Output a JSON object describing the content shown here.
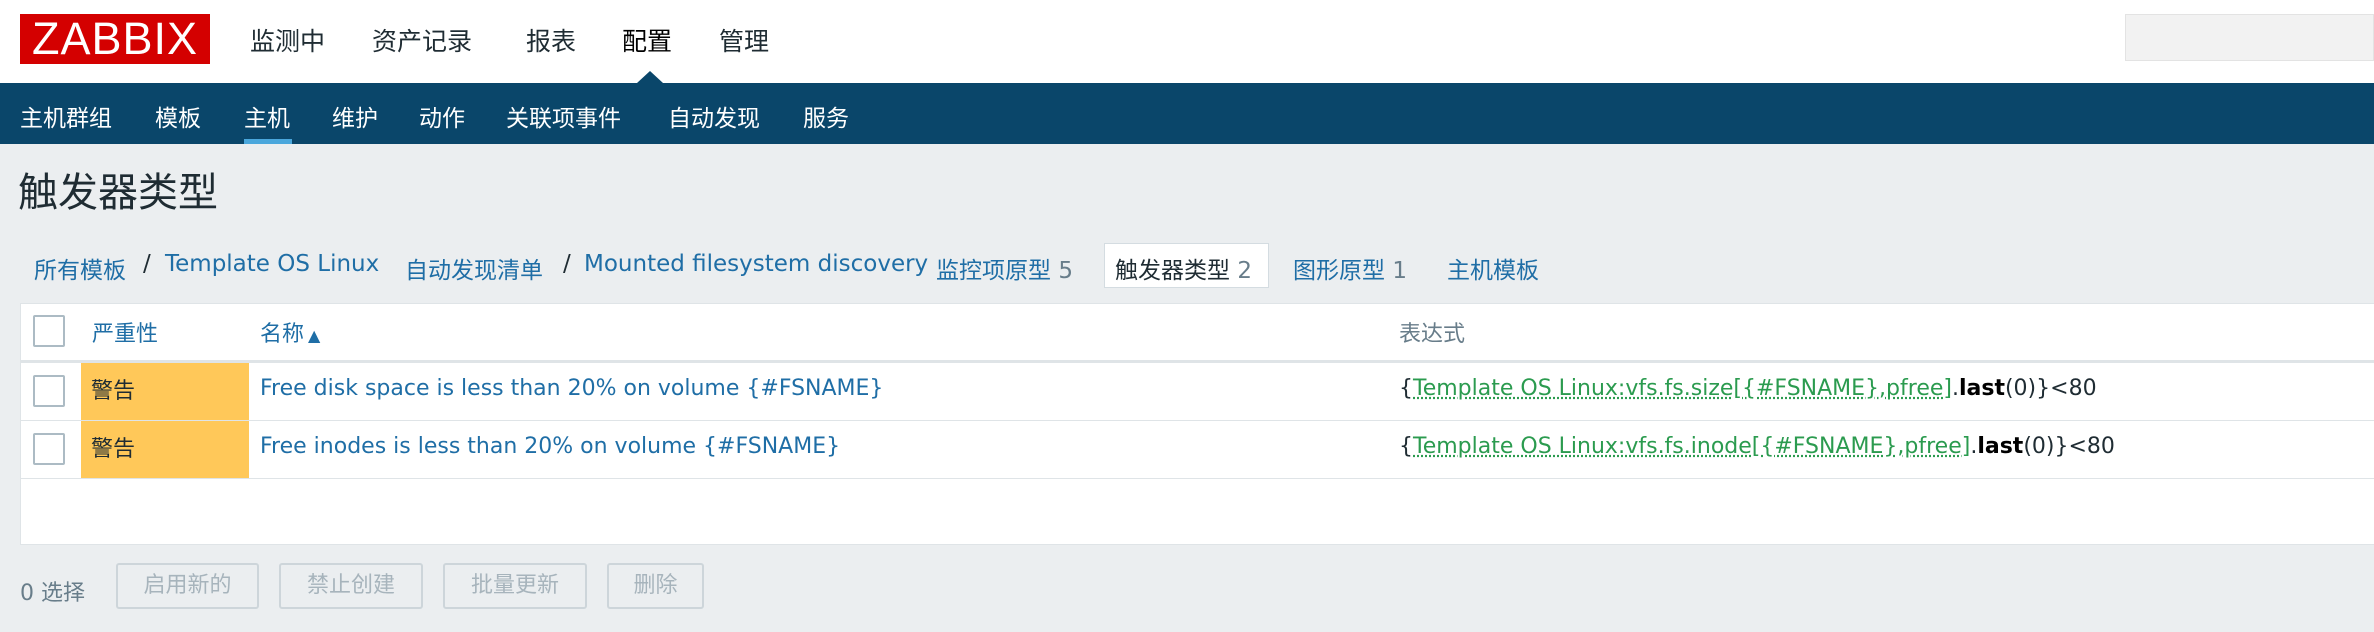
{
  "logo": "ZABBIX",
  "top_menu": [
    "监测中",
    "资产记录",
    "报表",
    "配置",
    "管理"
  ],
  "sub_nav": [
    "主机群组",
    "模板",
    "主机",
    "维护",
    "动作",
    "关联项事件",
    "自动发现",
    "服务"
  ],
  "page_title": "触发器类型",
  "breadcrumbs": {
    "all_templates": "所有模板",
    "sep1": "/",
    "template": "Template OS Linux",
    "discovery_list": "自动发现清单",
    "sep2": "/",
    "discovery_rule": "Mounted filesystem discovery",
    "item_prototypes": "监控项原型",
    "item_prototypes_count": "5",
    "trigger_prototypes": "触发器类型",
    "trigger_prototypes_count": "2",
    "graph_prototypes": "图形原型",
    "graph_prototypes_count": "1",
    "host_templates": "主机模板"
  },
  "table": {
    "headers": {
      "severity": "严重性",
      "name": "名称",
      "sort_indicator": "▲",
      "expression": "表达式"
    },
    "rows": [
      {
        "severity": "警告",
        "name": "Free disk space is less than 20% on volume {#FSNAME}",
        "expr": {
          "open": "{",
          "item": "Template OS Linux:vfs.fs.size[{#FSNAME},pfree]",
          "dot": ".",
          "func": "last",
          "args": "(0)",
          "close": "}<80"
        }
      },
      {
        "severity": "警告",
        "name": "Free inodes is less than 20% on volume {#FSNAME}",
        "expr": {
          "open": "{",
          "item": "Template OS Linux:vfs.fs.inode[{#FSNAME},pfree]",
          "dot": ".",
          "func": "last",
          "args": "(0)",
          "close": "}<80"
        }
      }
    ]
  },
  "footer": {
    "selected": "0 选择",
    "buttons": [
      "启用新的",
      "禁止创建",
      "批量更新",
      "删除"
    ]
  },
  "colors": {
    "brand_red": "#d40000",
    "nav_blue": "#0a466a",
    "link_blue": "#1f6ea6",
    "warning": "#ffc859",
    "template_green": "#2b9b4f"
  }
}
